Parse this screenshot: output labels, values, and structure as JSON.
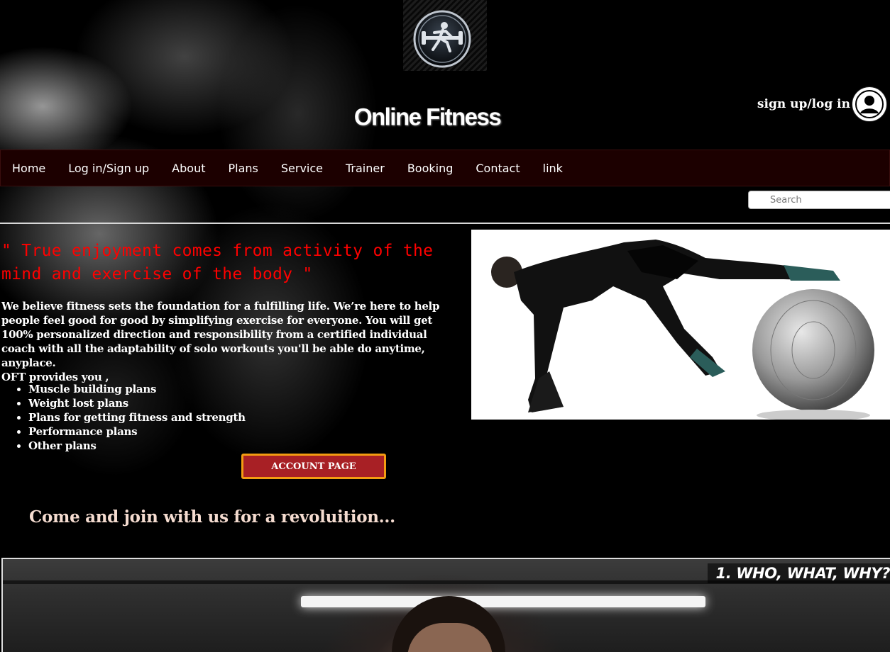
{
  "header": {
    "site_title": "Online Fitness",
    "signup_label": "sign up/log in"
  },
  "nav": {
    "items": [
      "Home",
      "Log in/Sign up",
      "About",
      "Plans",
      "Service",
      "Trainer",
      "Booking",
      "Contact",
      "link"
    ]
  },
  "search": {
    "placeholder": "Search"
  },
  "main": {
    "quote": "\" True enjoyment comes from activity of the mind and exercise of the body \"",
    "intro": "We believe fitness sets the foundation for a fulfilling life. We’re here to help people feel good for good by simplifying exercise for everyone. You will get 100% personalized direction and responsibility from a certified individual coach with all the adaptability of solo workouts you'll be able do anytime, anyplace.",
    "provides": "OFT provides you ,",
    "plans": [
      "Muscle building plans",
      "Weight lost plans",
      "Plans for getting fitness and strength",
      "Performance plans",
      "Other plans"
    ],
    "account_button": "ACCOUNT PAGE",
    "tagline": "Come and join with us for a revoluition..."
  },
  "video": {
    "title": "1. WHO, WHAT, WHY?"
  },
  "colors": {
    "nav_bg": "#1c0000",
    "quote": "#ff0000",
    "button_bg": "#a82025",
    "button_border": "#f39c12"
  }
}
